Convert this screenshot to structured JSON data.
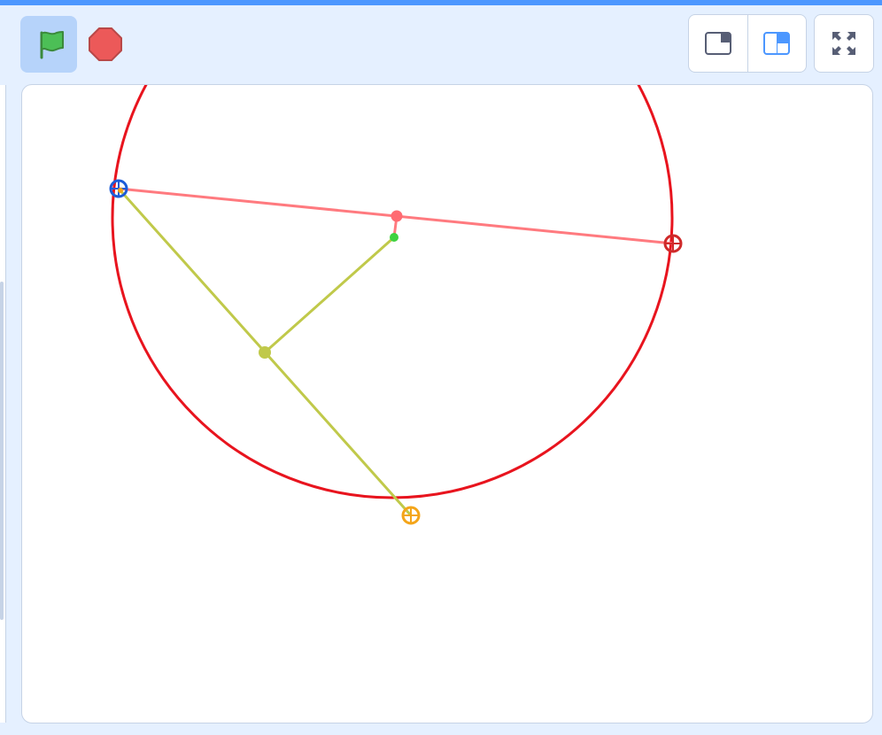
{
  "toolbar": {
    "green_flag_icon": "green-flag-icon",
    "stop_icon": "stop-sign-icon",
    "small_stage_icon": "small-stage-icon",
    "normal_stage_icon": "normal-stage-icon",
    "fullscreen_icon": "fullscreen-icon"
  },
  "colors": {
    "top_bar": "#4c97ff",
    "background": "#e5f0ff",
    "circle": "#e8141e",
    "chord": "#ff7a7f",
    "yellow_green": "#c0c94a",
    "blue_marker": "#1d5cd8",
    "red_marker": "#cf2a2a",
    "orange_marker": "#f4a51a",
    "green_dot": "#3fd23f"
  }
}
